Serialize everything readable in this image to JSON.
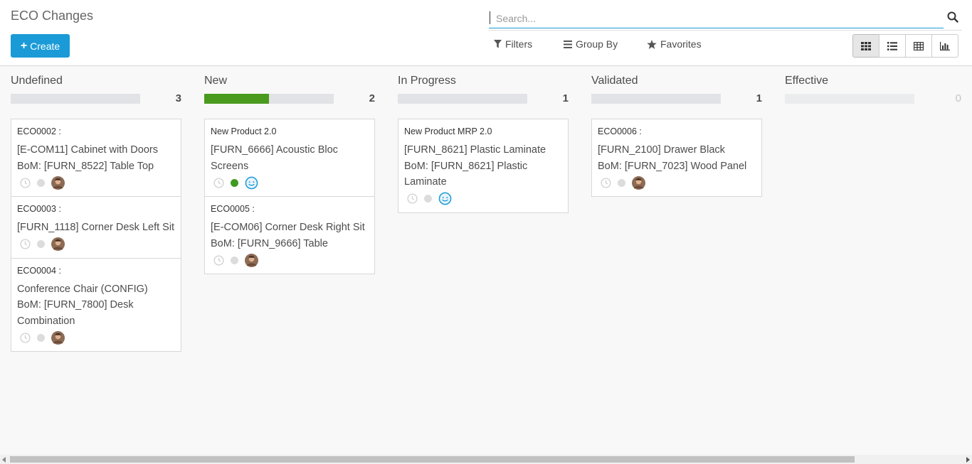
{
  "header": {
    "title": "ECO Changes",
    "create_label": "Create"
  },
  "search": {
    "placeholder": "Search..."
  },
  "filters": {
    "filters_label": "Filters",
    "groupby_label": "Group By",
    "favorites_label": "Favorites"
  },
  "views": [
    {
      "icon": "kanban-icon",
      "active": true
    },
    {
      "icon": "list-icon",
      "active": false
    },
    {
      "icon": "pivot-icon",
      "active": false
    },
    {
      "icon": "graph-icon",
      "active": false
    }
  ],
  "columns": [
    {
      "title": "Undefined",
      "count": "3",
      "progress_fraction": 0,
      "cards": [
        {
          "ref": "ECO0002 :",
          "name": "[E-COM11] Cabinet with Doors",
          "bom": "BoM: [FURN_8522] Table Top",
          "status": "grey",
          "assignee": "avatar"
        },
        {
          "ref": "ECO0003 :",
          "name": "[FURN_1118] Corner Desk Left Sit",
          "bom": "",
          "status": "grey",
          "assignee": "avatar"
        },
        {
          "ref": "ECO0004 :",
          "name": "Conference Chair (CONFIG)",
          "bom": "BoM: [FURN_7800] Desk Combination",
          "status": "grey",
          "assignee": "avatar"
        }
      ]
    },
    {
      "title": "New",
      "count": "2",
      "progress_fraction": 0.5,
      "cards": [
        {
          "ref": "New Product 2.0",
          "name": "[FURN_6666] Acoustic Bloc Screens",
          "bom": "",
          "status": "green",
          "assignee": "smiley"
        },
        {
          "ref": "ECO0005 :",
          "name": "[E-COM06] Corner Desk Right Sit",
          "bom": "BoM: [FURN_9666] Table",
          "status": "grey",
          "assignee": "avatar"
        }
      ]
    },
    {
      "title": "In Progress",
      "count": "1",
      "progress_fraction": 0,
      "cards": [
        {
          "ref": "New Product MRP 2.0",
          "name": "[FURN_8621] Plastic Laminate",
          "bom": "BoM: [FURN_8621] Plastic Laminate",
          "status": "grey",
          "assignee": "smiley"
        }
      ]
    },
    {
      "title": "Validated",
      "count": "1",
      "progress_fraction": 0,
      "cards": [
        {
          "ref": "ECO0006 :",
          "name": "[FURN_2100] Drawer Black",
          "bom": "BoM: [FURN_7023] Wood Panel",
          "status": "grey",
          "assignee": "avatar"
        }
      ]
    },
    {
      "title": "Effective",
      "count": "0",
      "progress_fraction": 0,
      "cards": []
    }
  ],
  "colors": {
    "primary": "#1a9bd7",
    "progress_green": "#4a9a1e",
    "status_green": "#3f9a21"
  }
}
